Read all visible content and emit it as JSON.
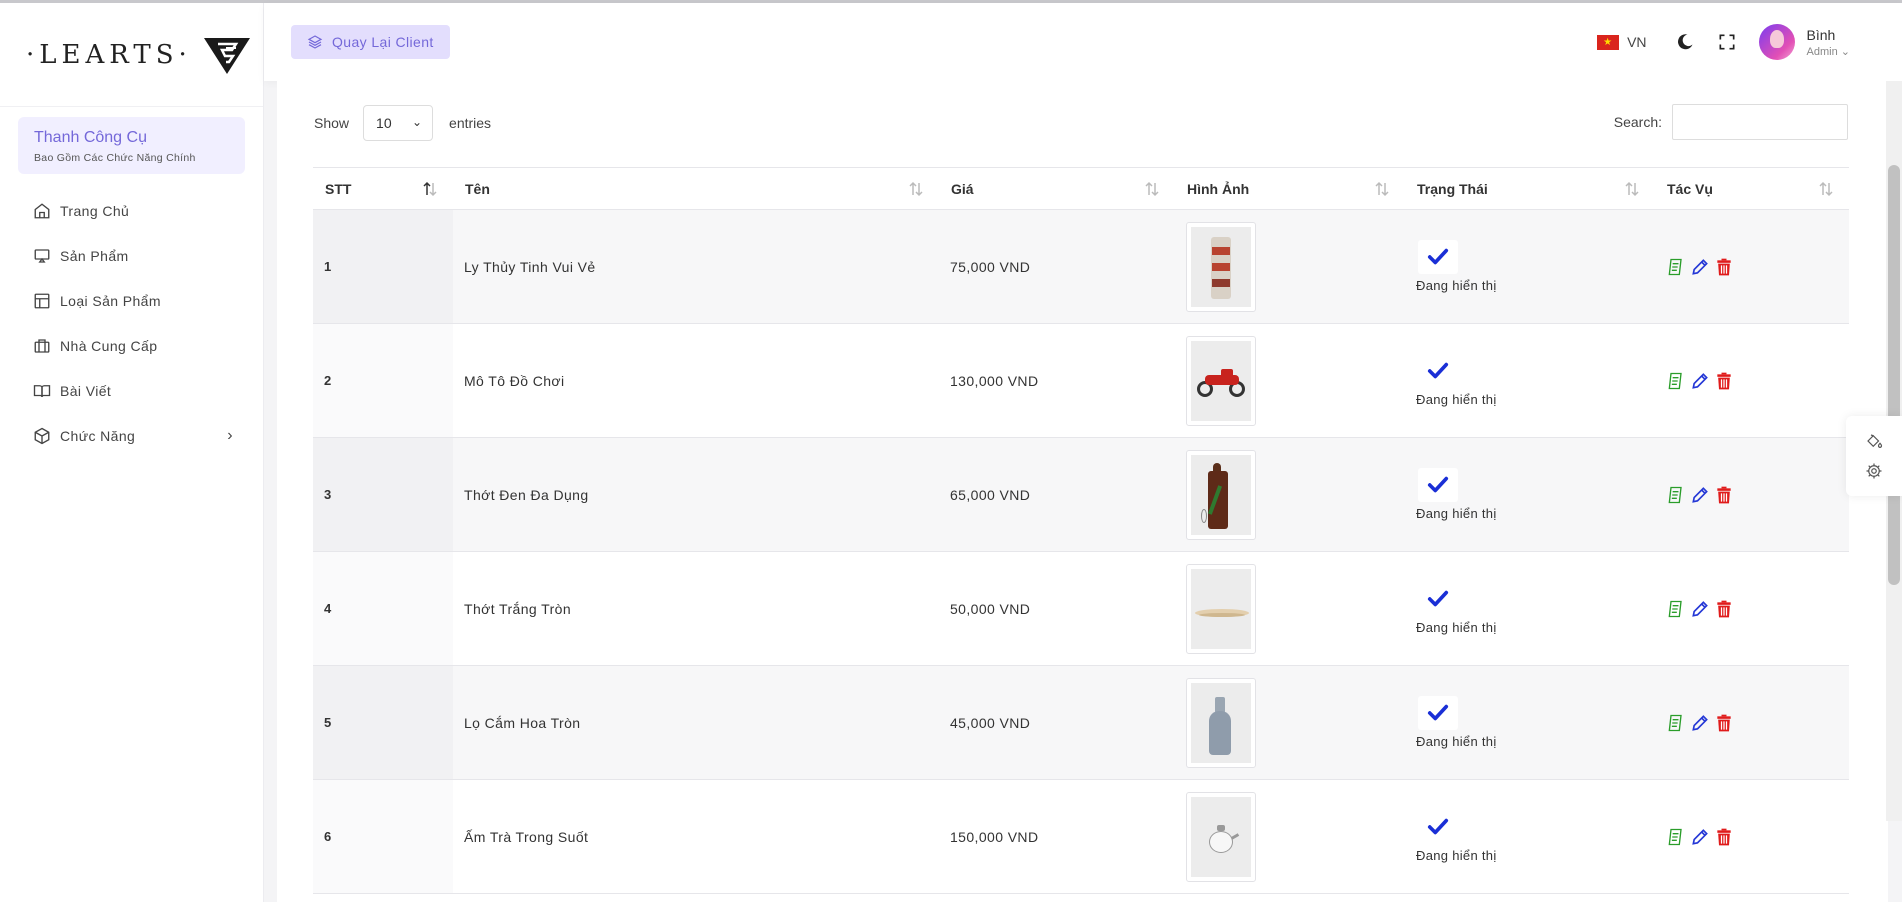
{
  "app": {
    "logo_text": "·LEARTS·"
  },
  "sidebar": {
    "tool_title": "Thanh Công Cụ",
    "tool_subtitle": "Bao Gồm Các Chức Năng Chính",
    "items": [
      {
        "label": "Trang Chủ",
        "icon": "home-icon"
      },
      {
        "label": "Sản Phẩm",
        "icon": "monitor-icon"
      },
      {
        "label": "Loại Sản Phẩm",
        "icon": "layout-icon"
      },
      {
        "label": "Nhà Cung Cấp",
        "icon": "briefcase-icon"
      },
      {
        "label": "Bài Viết",
        "icon": "book-icon"
      },
      {
        "label": "Chức Năng",
        "icon": "box-icon",
        "chevron": "›"
      }
    ]
  },
  "header": {
    "back_label": "Quay Lại Client",
    "lang": "VN",
    "user_name": "Bình",
    "user_role": "Admin ⌄"
  },
  "table_controls": {
    "show_label": "Show",
    "entries_value": "10",
    "entries_label": "entries",
    "search_label": "Search:"
  },
  "table": {
    "columns": [
      "STT",
      "Tên",
      "Giá",
      "Hình Ảnh",
      "Trạng Thái",
      "Tác Vụ"
    ],
    "rows": [
      {
        "stt": "1",
        "name": "Ly Thủy Tinh Vui Vẻ",
        "price": "75,000 VND",
        "status": "Đang hiển thị",
        "image": "glass"
      },
      {
        "stt": "2",
        "name": "Mô Tô Đồ Chơi",
        "price": "130,000 VND",
        "status": "Đang hiển thị",
        "image": "motorbike"
      },
      {
        "stt": "3",
        "name": "Thớt Đen Đa Dụng",
        "price": "65,000 VND",
        "status": "Đang hiển thị",
        "image": "board-dark"
      },
      {
        "stt": "4",
        "name": "Thớt Trắng Tròn",
        "price": "50,000 VND",
        "status": "Đang hiển thị",
        "image": "board-round"
      },
      {
        "stt": "5",
        "name": "Lọ Cắm Hoa Tròn",
        "price": "45,000 VND",
        "status": "Đang hiển thị",
        "image": "vase"
      },
      {
        "stt": "6",
        "name": "Ấm Trà Trong Suốt",
        "price": "150,000 VND",
        "status": "Đang hiển thị",
        "image": "teapot"
      }
    ]
  },
  "colors": {
    "accent": "#7468d9",
    "accent_bg": "#e3defd",
    "check": "#1a2fd6",
    "action_view": "#2a9d2a",
    "action_edit": "#2437d6",
    "action_delete": "#e01b1b"
  }
}
